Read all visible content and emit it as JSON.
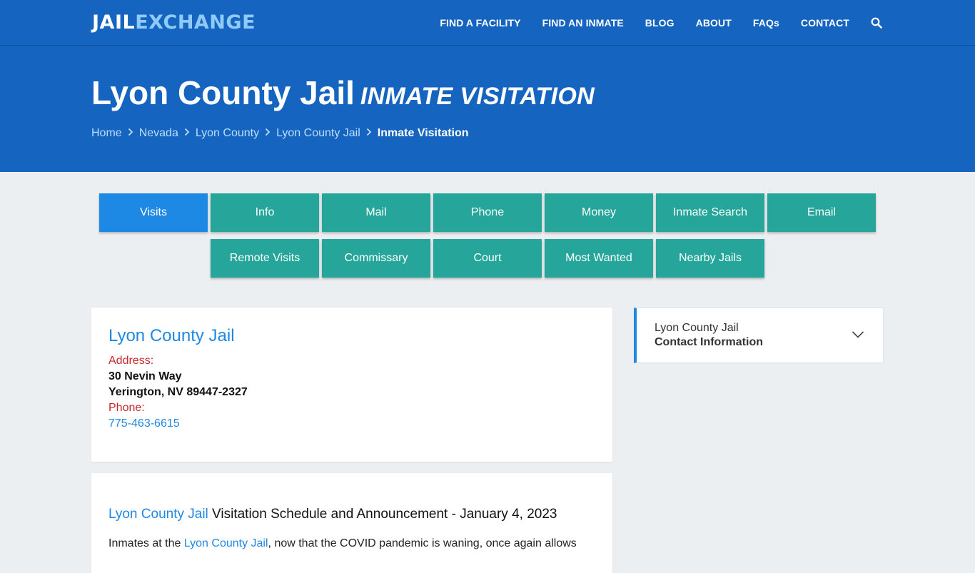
{
  "header": {
    "logo_jail": "JAIL",
    "logo_exchange": "EXCHANGE",
    "nav": {
      "find_facility": "FIND A FACILITY",
      "find_inmate": "FIND AN INMATE",
      "blog": "BLOG",
      "about": "ABOUT",
      "faqs": "FAQs",
      "contact": "CONTACT"
    },
    "search_icon": "search-icon"
  },
  "hero": {
    "title": "Lyon County Jail",
    "subtitle": "INMATE VISITATION",
    "breadcrumb": {
      "home": "Home",
      "state": "Nevada",
      "county": "Lyon County",
      "facility": "Lyon County Jail",
      "current": "Inmate Visitation"
    }
  },
  "tabs": {
    "row1": {
      "visits": "Visits",
      "info": "Info",
      "mail": "Mail",
      "phone": "Phone",
      "money": "Money",
      "inmate_search": "Inmate Search",
      "email": "Email"
    },
    "row2": {
      "remote_visits": "Remote Visits",
      "commissary": "Commissary",
      "court": "Court",
      "most_wanted": "Most Wanted",
      "nearby_jails": "Nearby Jails"
    },
    "active": "Visits"
  },
  "contact_card": {
    "facility_name": "Lyon County Jail",
    "address_label": "Address:",
    "address_line1": "30 Nevin Way",
    "address_line2": "Yerington, NV 89447-2327",
    "phone_label": "Phone:",
    "phone": "775-463-6615"
  },
  "visit_card": {
    "heading_link": "Lyon County Jail",
    "heading_text": " Visitation Schedule and Announcement - January 4, 2023",
    "para_start": "Inmates at the ",
    "para_link": "Lyon County Jail",
    "para_rest": ", now that the COVID pandemic is waning, once again allows"
  },
  "sidebar": {
    "facility_name": "Lyon County Jail",
    "section_label": "Contact Information"
  },
  "colors": {
    "brand_blue": "#1565c0",
    "accent_blue": "#1e88e5",
    "tab_teal": "#26a69a",
    "label_red": "#c62828",
    "logo_light": "#90caf9"
  }
}
